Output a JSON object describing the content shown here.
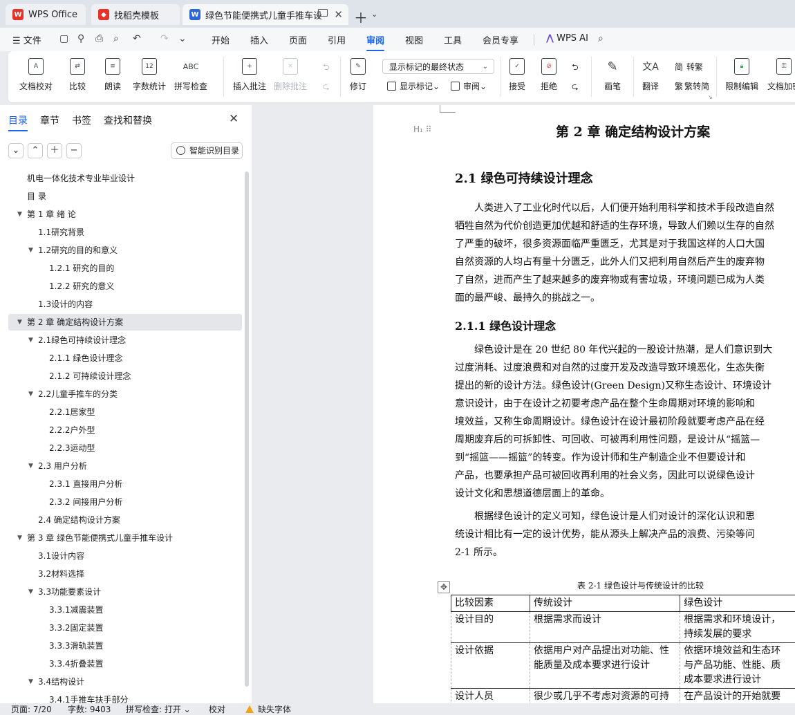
{
  "tabs": [
    {
      "label": "WPS Office",
      "icon": "wps-logo-icon",
      "color": "#e8302a"
    },
    {
      "label": "找稻壳模板",
      "icon": "docer-logo-icon",
      "color": "#e8302a"
    },
    {
      "label": "绿色节能便携式儿童手推车设计",
      "icon": "writer-doc-icon",
      "color": "#2b65d9"
    }
  ],
  "menu": {
    "file": "文件",
    "items": [
      "开始",
      "插入",
      "页面",
      "引用",
      "审阅",
      "视图",
      "工具",
      "会员专享"
    ],
    "active": "审阅",
    "ai": "WPS AI"
  },
  "ribbon": {
    "doc_check": "文档校对",
    "compare": "比较",
    "read_aloud": "朗读",
    "word_count": "字数统计",
    "word_count_icon": "12",
    "spell_check": "拼写检查",
    "spell_icon": "ABC",
    "insert_comment": "插入批注",
    "delete_comment": "删除批注",
    "revise": "修订",
    "markup_select": "显示标记的最终状态",
    "show_markup": "显示标记",
    "review": "审阅",
    "accept": "接受",
    "reject": "拒绝",
    "pen": "画笔",
    "translate": "翻译",
    "to_traditional": "转繁",
    "to_simplified": "繁转简",
    "restrict_edit": "限制编辑",
    "doc_encrypt": "文档加密"
  },
  "nav": {
    "tabs": [
      "目录",
      "章节",
      "书签",
      "查找和替换"
    ],
    "active_tab": "目录",
    "smart_toc": "智能识别目录",
    "toc": [
      {
        "text": "机电一体化技术专业毕业设计",
        "level": 0,
        "arrow": false
      },
      {
        "text": "目 录",
        "level": 0,
        "arrow": false
      },
      {
        "text": "第 1 章  绪  论",
        "level": 0,
        "arrow": true
      },
      {
        "text": "1.1研究背景",
        "level": 1,
        "arrow": false
      },
      {
        "text": "1.2研究的目的和意义",
        "level": 1,
        "arrow": true
      },
      {
        "text": "1.2.1  研究的目的",
        "level": 2,
        "arrow": false
      },
      {
        "text": "1.2.2  研究的意义",
        "level": 2,
        "arrow": false
      },
      {
        "text": "1.3设计的内容",
        "level": 1,
        "arrow": false
      },
      {
        "text": "第 2 章  确定结构设计方案",
        "level": 0,
        "arrow": true,
        "selected": true
      },
      {
        "text": "2.1绿色可持续设计理念",
        "level": 1,
        "arrow": true
      },
      {
        "text": "2.1.1  绿色设计理念",
        "level": 2,
        "arrow": false
      },
      {
        "text": "2.1.2  可持续设计理念",
        "level": 2,
        "arrow": false
      },
      {
        "text": "2.2儿童手推车的分类",
        "level": 1,
        "arrow": true
      },
      {
        "text": "2.2.1居家型",
        "level": 2,
        "arrow": false
      },
      {
        "text": "2.2.2户外型",
        "level": 2,
        "arrow": false
      },
      {
        "text": "2.2.3运动型",
        "level": 2,
        "arrow": false
      },
      {
        "text": "2.3  用户分析",
        "level": 1,
        "arrow": true
      },
      {
        "text": "2.3.1  直接用户分析",
        "level": 2,
        "arrow": false
      },
      {
        "text": "2.3.2  间接用户分析",
        "level": 2,
        "arrow": false
      },
      {
        "text": "2.4  确定结构设计方案",
        "level": 1,
        "arrow": false
      },
      {
        "text": "第 3 章  绿色节能便携式儿童手推车设计",
        "level": 0,
        "arrow": true
      },
      {
        "text": "3.1设计内容",
        "level": 1,
        "arrow": false
      },
      {
        "text": "3.2材料选择",
        "level": 1,
        "arrow": false
      },
      {
        "text": "3.3功能要素设计",
        "level": 1,
        "arrow": true
      },
      {
        "text": "3.3.1减震装置",
        "level": 2,
        "arrow": false
      },
      {
        "text": "3.3.2固定装置",
        "level": 2,
        "arrow": false
      },
      {
        "text": "3.3.3滑轨装置",
        "level": 2,
        "arrow": false
      },
      {
        "text": "3.3.4折叠装置",
        "level": 2,
        "arrow": false
      },
      {
        "text": "3.4结构设计",
        "level": 1,
        "arrow": true
      },
      {
        "text": "3.4.1手推车扶手部分",
        "level": 2,
        "arrow": false
      }
    ]
  },
  "doc": {
    "chapter": "第 2 章     确定结构设计方案",
    "h2": "2.1  绿色可持续设计理念",
    "para1": [
      "　　人类进入了工业化时代以后，人们便开始利用科学和技术手段改造自然",
      "牺牲自然为代价创造更加优越和舒适的生存环境，导致人们赖以生存的自然",
      "了严重的破坏，很多资源面临严重匮乏，尤其是对于我国这样的人口大国",
      "自然资源的人均占有量十分匮乏，此外人们又把利用自然后产生的废弃物",
      "了自然，进而产生了越来越多的废弃物或有害垃圾，环境问题已成为人类",
      "面的最严峻、最持久的挑战之一。"
    ],
    "h3": "2.1.1    绿色设计理念",
    "para2": [
      "　　绿色设计是在 20 世纪 80 年代兴起的一股设计热潮，是人们意识到大",
      "过度消耗、过度浪费和对自然的过度开发及改造导致环境恶化，生态失衡",
      "提出的新的设计方法。绿色设计(Green Design)又称生态设计、环境设计",
      "意识设计，由于在设计之初要考虑产品在整个生命周期对环境的影响和",
      "境效益，又称生命周期设计。绿色设计在设计最初阶段就要考虑产品在经",
      "周期废弃后的可拆卸性、可回收、可被再利用性问题，是设计从“摇篮—",
      "到“摇篮——摇篮”的转变。作为设计师和生产制造企业不但要设计和",
      "产品，也要承担产品可被回收再利用的社会义务，因此可以说绿色设计",
      "设计文化和思想道德层面上的革命。"
    ],
    "para3": [
      "　　根据绿色设计的定义可知，绿色设计是人们对设计的深化认识和思",
      "统设计相比有一定的设计优势，能从源头上解决产品的浪费、污染等问",
      "2-1 所示。"
    ],
    "table_caption": "表 2-1  绿色设计与传统设计的比较",
    "table": {
      "headers": [
        "比较因素",
        "传统设计",
        "绿色设计"
      ],
      "rows": [
        [
          "设计目的",
          "根据需求而设计",
          "根据需求和环境设计，\n持续发展的要求"
        ],
        [
          "设计依据",
          "依据用户对产品提出对功能、性\n能质量及成本要求进行设计",
          "依据环境效益和生态环\n与产品功能、性能、质\n成本要求进行设计"
        ],
        [
          "设计人员",
          "很少或几乎不考虑对资源的可持\n续发展或不考虑环境的影响",
          "在产品设计的开始就要\n品的环境属性，资源能"
        ]
      ]
    }
  },
  "status": {
    "page": "页面: 7/20",
    "words": "字数: 9403",
    "spell": "拼写检查: 打开",
    "proof": "校对",
    "missing_font": "缺失字体"
  }
}
